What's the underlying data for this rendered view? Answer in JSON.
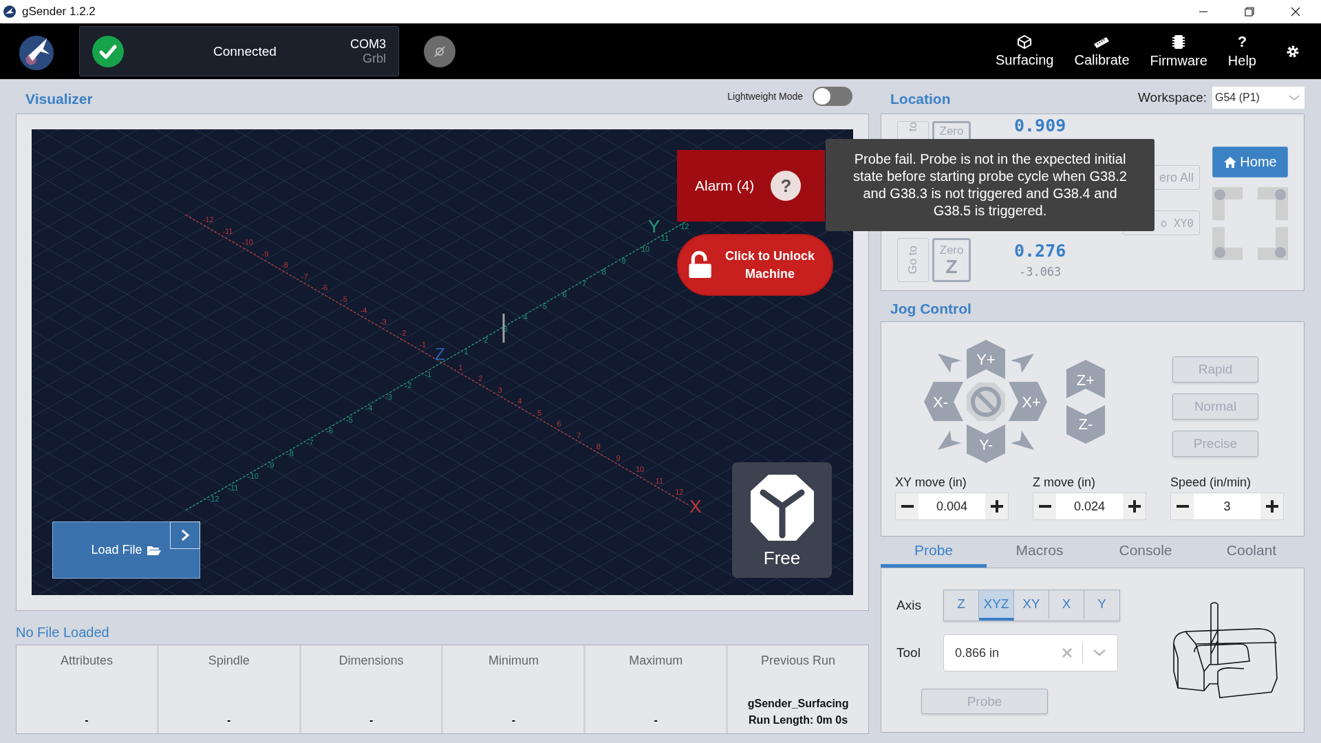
{
  "window": {
    "title": "gSender 1.2.2"
  },
  "header": {
    "connection": {
      "status": "Connected",
      "connected": true,
      "port": "COM3",
      "firmware": "Grbl"
    },
    "nav": [
      {
        "label": "Surfacing"
      },
      {
        "label": "Calibrate"
      },
      {
        "label": "Firmware"
      },
      {
        "label": "Help",
        "glyph": "?"
      }
    ]
  },
  "visualizer": {
    "title": "Visualizer",
    "lightweight_mode": {
      "label": "Lightweight Mode",
      "on": false
    },
    "axes": {
      "x": "X",
      "y": "Y",
      "z": "Z"
    },
    "x_ticks": [
      "-12",
      "-11",
      "-10",
      "-9",
      "-8",
      "-7",
      "-6",
      "-5",
      "-4",
      "-3",
      "-2",
      "-1",
      "1",
      "2",
      "3",
      "4",
      "5",
      "6",
      "7",
      "8",
      "9",
      "10",
      "11",
      "12"
    ],
    "y_ticks": [
      "-12",
      "-11",
      "-10",
      "-9",
      "-8",
      "-7",
      "-6",
      "-5",
      "-4",
      "-3",
      "-2",
      "-1",
      "1",
      "2",
      "3",
      "4",
      "5",
      "6",
      "7",
      "8",
      "9",
      "10",
      "11",
      "12"
    ],
    "alarm": {
      "label": "Alarm (4)",
      "help": "?"
    },
    "tooltip": "Probe fail. Probe is not in the expected initial state before starting probe cycle when G38.2 and G38.3 is not triggered and G38.4 and G38.5 is triggered.",
    "unlock": "Click to Unlock Machine",
    "load_file": "Load File",
    "camera": "Free"
  },
  "file_info": {
    "title": "No File Loaded",
    "columns": [
      {
        "label": "Attributes",
        "lines": [
          "-"
        ]
      },
      {
        "label": "Spindle",
        "lines": [
          "-"
        ]
      },
      {
        "label": "Dimensions",
        "lines": [
          "-"
        ]
      },
      {
        "label": "Minimum",
        "lines": [
          "-"
        ]
      },
      {
        "label": "Maximum",
        "lines": [
          "-"
        ]
      },
      {
        "label": "Previous Run",
        "lines": [
          "gSender_Surfacing",
          "Run Length: 0m 0s"
        ]
      }
    ]
  },
  "location": {
    "title": "Location",
    "workspace_label": "Workspace:",
    "workspace": "G54 (P1)",
    "x_row": {
      "goto": "to",
      "zero": "Zero",
      "value": "0.909"
    },
    "z_row": {
      "goto": "Go to",
      "zero": "Zero",
      "zero_axis": "Z",
      "value": "0.276",
      "machine": "-3.063"
    },
    "zero_all": "ero All",
    "goto_xy0": "o XY0",
    "home": "Home"
  },
  "jog": {
    "title": "Jog Control",
    "buttons": {
      "y_plus": "Y+",
      "x_minus": "X-",
      "x_plus": "X+",
      "y_minus": "Y-",
      "z_plus": "Z+",
      "z_minus": "Z-"
    },
    "presets": [
      {
        "label": "Rapid",
        "disabled": true
      },
      {
        "label": "Normal",
        "disabled": true
      },
      {
        "label": "Precise",
        "disabled": true
      }
    ],
    "steppers": [
      {
        "label": "XY move (in)",
        "value": "0.004"
      },
      {
        "label": "Z move (in)",
        "value": "0.024"
      },
      {
        "label": "Speed (in/min)",
        "value": "3"
      }
    ]
  },
  "tools": {
    "tabs": [
      {
        "label": "Probe",
        "selected": true
      },
      {
        "label": "Macros",
        "selected": false
      },
      {
        "label": "Console",
        "selected": false
      },
      {
        "label": "Coolant",
        "selected": false
      }
    ],
    "axis_label": "Axis",
    "axes": [
      {
        "label": "Z",
        "selected": false
      },
      {
        "label": "XYZ",
        "selected": true
      },
      {
        "label": "XY",
        "selected": false
      },
      {
        "label": "X",
        "selected": false
      },
      {
        "label": "Y",
        "selected": false
      }
    ],
    "tool_label": "Tool",
    "tool": "0.866 in",
    "probe_button": {
      "label": "Probe",
      "disabled": true
    }
  }
}
